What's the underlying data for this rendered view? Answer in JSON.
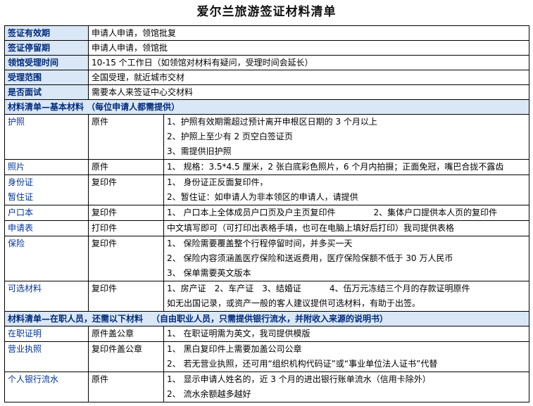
{
  "title": "爱尔兰旅游签证材料清单",
  "info_rows": [
    {
      "label": "签证有效期",
      "value": "申请人申请，领馆批复"
    },
    {
      "label": "签证停留期",
      "value": "申请人申请，领馆批"
    },
    {
      "label": "领馆受理时间",
      "value": "10-15 个工作日（如领馆对材料有疑问，受理时间会延长）"
    },
    {
      "label": "受理范围",
      "value": "全国受理，就近城市交材"
    },
    {
      "label": "是否面试",
      "value": "需要本人来签证中心交材料"
    }
  ],
  "section1": {
    "header": "材料清单—基本材料 （每位申请人都需提供）",
    "rows": [
      {
        "name": "护照",
        "type": "原件",
        "lines": [
          "1、护照有效期需超过预计离开申根区日期的 3 个月以上",
          "2、护照上至少有 2 页空白签证页",
          "3、需提供旧护照"
        ]
      },
      {
        "name": "照片",
        "type": "原件",
        "lines": [
          "1、 规格：3.5*4.5 厘米，2 张白底彩色照片，6 个月内拍摄；正面免冠，嘴巴合拢不露齿"
        ]
      },
      {
        "name": "身份证",
        "name2": "暂住证",
        "type": "复印件",
        "lines": [
          "1、 身份证正反面复印件，",
          "2、暂住证：如申请人为非本领区的申请人，请提供"
        ]
      },
      {
        "name": "户口本",
        "type": "复印件",
        "line_a": "1、 户口本上全体成员户口页及户主页复印件",
        "line_b": "2、集体户口提供本人页的复印件"
      },
      {
        "name": "申请表",
        "type": "打印件",
        "lines": [
          "中文填写即可（可打印出表格手填，也可在电脑上填好后打印）我司提供表格"
        ]
      },
      {
        "name": "保险",
        "type": "复印件",
        "lines": [
          "1、 保险需要覆盖整个行程停留时间，并多买一天",
          "2、 保险内容须涵盖医疗保险和送返费用，医疗保险保额不低于 30 万人民币",
          "3、 保单需要英文版本"
        ]
      },
      {
        "name": "可选材料",
        "type": "复印件",
        "items": [
          "1、房产证",
          "2、车产证",
          "3、结婚证",
          "4、伍万元冻结三个月的存款证明原件"
        ],
        "line2": "如无出国记录，或资产一般的客人建议提供可选材料，有助于出签。"
      }
    ]
  },
  "section2": {
    "header": "材料清单—在职人员，还需以下材料",
    "header_note": "（自由职业人员，只需提供银行流水，并附收入来源的说明书）",
    "rows": [
      {
        "name": "在职证明",
        "type": "原件盖公章",
        "lines": [
          "1、 在职证明需为英文，我司提供模版"
        ]
      },
      {
        "name": "营业执照",
        "type": "复印件盖公章",
        "lines": [
          "1、 黑白复印件上需要加盖公司公章",
          "2、 若无营业执照，还可用“组织机构代码证”或“事业单位法人证书”代替"
        ]
      },
      {
        "name": "个人银行流水",
        "type": "原件",
        "lines": [
          "1、 显示申请人姓名的，近 3 个月的进出银行账单流水（信用卡除外）",
          "2、 流水余额越多越好"
        ]
      }
    ]
  }
}
